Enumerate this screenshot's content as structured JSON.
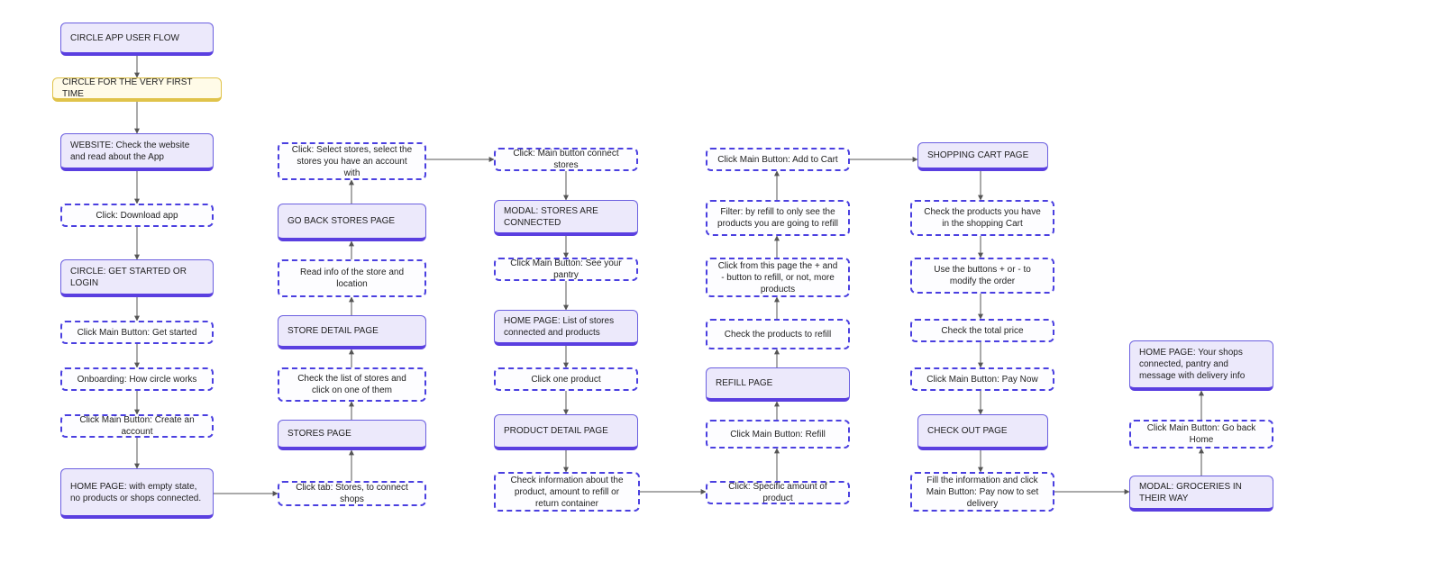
{
  "colors": {
    "page_fill": "#ece9fb",
    "page_border": "#6b5fe0",
    "page_accent": "#5a3fe0",
    "start_fill": "#fffbe8",
    "start_border": "#e0c34a",
    "action_border": "#4a3fe0"
  },
  "nodes": {
    "n1": {
      "text": "CIRCLE APP USER FLOW"
    },
    "n2": {
      "text": "CIRCLE FOR THE VERY FIRST TIME"
    },
    "n3": {
      "text": "WEBSITE: Check the website and read about the App"
    },
    "n4": {
      "text": "Click: Download app"
    },
    "n5": {
      "text": "CIRCLE: GET STARTED OR LOGIN"
    },
    "n6": {
      "text": "Click Main Button: Get started"
    },
    "n7": {
      "text": "Onboarding: How circle works"
    },
    "n8": {
      "text": "Click Main Button: Create an account"
    },
    "n9": {
      "text": "HOME PAGE: with empty state, no products or shops connected."
    },
    "n10": {
      "text": "Click: Select stores, select the stores you have an account with"
    },
    "n11": {
      "text": "GO BACK STORES PAGE"
    },
    "n12": {
      "text": "Read info of the store and location"
    },
    "n13": {
      "text": "STORE DETAIL PAGE"
    },
    "n14": {
      "text": "Check the list of stores and click on one of them"
    },
    "n15": {
      "text": "STORES PAGE"
    },
    "n16": {
      "text": "Click tab: Stores, to connect shops"
    },
    "n17": {
      "text": "Click: Main button connect stores"
    },
    "n18": {
      "text": "MODAL: STORES ARE CONNECTED"
    },
    "n19": {
      "text": "Click Main Button: See your pantry"
    },
    "n20": {
      "text": "HOME PAGE: List of stores connected and products"
    },
    "n21": {
      "text": "Click one product"
    },
    "n22": {
      "text": "PRODUCT DETAIL PAGE"
    },
    "n23": {
      "text": "Check information about the product, amount to refill or return container"
    },
    "n24": {
      "text": "Click Main Button: Add to Cart"
    },
    "n25": {
      "text": "Filter: by refill to only see the products you are going to refill"
    },
    "n26": {
      "text": "Click from this page the + and - button to refill, or not, more products"
    },
    "n27": {
      "text": "Check the products to refill"
    },
    "n28": {
      "text": "REFILL PAGE"
    },
    "n29": {
      "text": "Click Main Button: Refill"
    },
    "n30": {
      "text": "Click: Specific amount of product"
    },
    "n31": {
      "text": "SHOPPING CART PAGE"
    },
    "n32": {
      "text": "Check the products you have in the shopping Cart"
    },
    "n33": {
      "text": "Use the buttons + or - to modify the order"
    },
    "n34": {
      "text": "Check the total price"
    },
    "n35": {
      "text": "Click Main Button: Pay Now"
    },
    "n36": {
      "text": "CHECK OUT PAGE"
    },
    "n37": {
      "text": "Fill the information and click Main Button: Pay now to set delivery"
    },
    "n38": {
      "text": "HOME PAGE: Your shops connected, pantry and message with delivery info"
    },
    "n39": {
      "text": "Click Main Button: Go back Home"
    },
    "n40": {
      "text": "MODAL: GROCERIES IN THEIR WAY"
    }
  }
}
